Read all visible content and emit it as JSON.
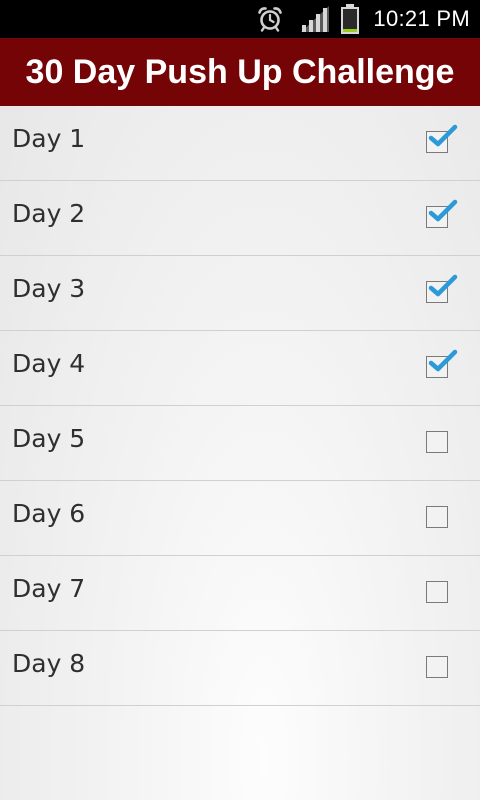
{
  "status_bar": {
    "time": "10:21 PM",
    "icons": [
      "alarm-clock-icon",
      "signal-strength-icon",
      "battery-icon"
    ]
  },
  "header": {
    "title": "30 Day Push Up Challenge",
    "background_color": "#750406"
  },
  "days": [
    {
      "label": "Day 1",
      "checked": true
    },
    {
      "label": "Day 2",
      "checked": true
    },
    {
      "label": "Day 3",
      "checked": true
    },
    {
      "label": "Day 4",
      "checked": true
    },
    {
      "label": "Day 5",
      "checked": false
    },
    {
      "label": "Day 6",
      "checked": false
    },
    {
      "label": "Day 7",
      "checked": false
    },
    {
      "label": "Day 8",
      "checked": false
    }
  ],
  "colors": {
    "check_mark": "#2a9ad8"
  }
}
